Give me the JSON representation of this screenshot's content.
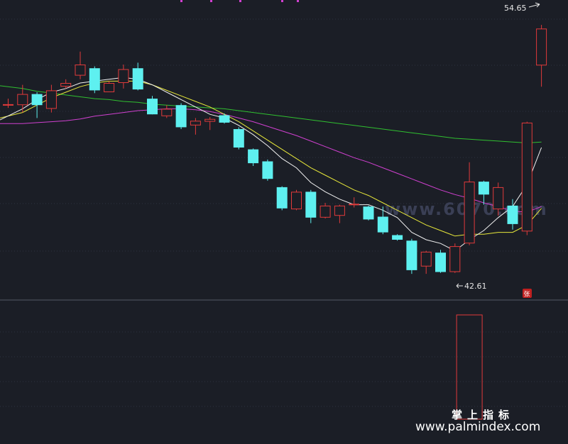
{
  "chart_data": {
    "type": "candlestick",
    "price_range": [
      41.0,
      56.0
    ],
    "high_label": "54.65",
    "low_label": "42.61",
    "limit_up_badge": "张",
    "watermark": "www.6070.com",
    "brand_cn": "掌上指标",
    "brand_url": "www.palmindex.com",
    "colors": {
      "background": "#1b1e26",
      "up": "#e03a3a",
      "down": "#5ef0f0",
      "ma5": "#f2f2f2",
      "ma10": "#e8e83a",
      "ma20": "#d040d0",
      "ma60": "#30c030",
      "grid": "#2e3240",
      "divider": "#555a66"
    },
    "candles": [
      {
        "open": 50.35,
        "close": 50.35,
        "high": 50.65,
        "low": 50.15
      },
      {
        "open": 50.3,
        "close": 50.9,
        "high": 51.4,
        "low": 49.9
      },
      {
        "open": 50.9,
        "close": 50.3,
        "high": 51.0,
        "low": 49.6
      },
      {
        "open": 50.1,
        "close": 51.1,
        "high": 51.4,
        "low": 49.9
      },
      {
        "open": 51.3,
        "close": 51.5,
        "high": 51.7,
        "low": 51.2
      },
      {
        "open": 51.9,
        "close": 52.5,
        "high": 53.2,
        "low": 51.7
      },
      {
        "open": 52.3,
        "close": 51.1,
        "high": 52.4,
        "low": 50.95
      },
      {
        "open": 51.0,
        "close": 51.5,
        "high": 51.6,
        "low": 51.0
      },
      {
        "open": 51.5,
        "close": 52.25,
        "high": 52.5,
        "low": 51.2
      },
      {
        "open": 52.3,
        "close": 51.15,
        "high": 52.6,
        "low": 51.1
      },
      {
        "open": 50.65,
        "close": 49.8,
        "high": 50.8,
        "low": 49.8
      },
      {
        "open": 49.7,
        "close": 50.1,
        "high": 50.3,
        "low": 49.6
      },
      {
        "open": 50.3,
        "close": 49.1,
        "high": 50.4,
        "low": 49.0
      },
      {
        "open": 49.2,
        "close": 49.45,
        "high": 49.6,
        "low": 48.7
      },
      {
        "open": 49.4,
        "close": 49.55,
        "high": 49.65,
        "low": 48.95
      },
      {
        "open": 49.75,
        "close": 49.35,
        "high": 49.85,
        "low": 49.3
      },
      {
        "open": 49.0,
        "close": 48.0,
        "high": 49.1,
        "low": 47.9
      },
      {
        "open": 47.9,
        "close": 47.15,
        "high": 47.95,
        "low": 47.0
      },
      {
        "open": 47.25,
        "close": 46.3,
        "high": 47.35,
        "low": 46.2
      },
      {
        "open": 45.85,
        "close": 44.7,
        "high": 45.9,
        "low": 44.6
      },
      {
        "open": 44.65,
        "close": 45.6,
        "high": 45.7,
        "low": 44.6
      },
      {
        "open": 45.6,
        "close": 44.2,
        "high": 45.7,
        "low": 43.9
      },
      {
        "open": 44.2,
        "close": 44.85,
        "high": 45.0,
        "low": 44.15
      },
      {
        "open": 44.3,
        "close": 44.85,
        "high": 44.9,
        "low": 43.9
      },
      {
        "open": 44.95,
        "close": 44.95,
        "high": 45.3,
        "low": 44.75
      },
      {
        "open": 44.8,
        "close": 44.1,
        "high": 44.85,
        "low": 44.05
      },
      {
        "open": 44.25,
        "close": 43.4,
        "high": 44.8,
        "low": 43.3
      },
      {
        "open": 43.25,
        "close": 43.0,
        "high": 43.3,
        "low": 42.95
      },
      {
        "open": 42.95,
        "close": 41.35,
        "high": 43.05,
        "low": 41.15
      },
      {
        "open": 41.55,
        "close": 42.35,
        "high": 42.4,
        "low": 41.15
      },
      {
        "open": 42.3,
        "close": 41.25,
        "high": 42.45,
        "low": 41.2
      },
      {
        "open": 41.25,
        "close": 42.65,
        "high": 42.8,
        "low": 41.2
      },
      {
        "open": 42.8,
        "close": 46.15,
        "high": 47.2,
        "low": 42.7
      },
      {
        "open": 46.15,
        "close": 45.45,
        "high": 46.2,
        "low": 44.9
      },
      {
        "open": 44.65,
        "close": 45.85,
        "high": 46.1,
        "low": 44.3
      },
      {
        "open": 44.85,
        "close": 43.85,
        "high": 45.2,
        "low": 43.55
      },
      {
        "open": 43.45,
        "close": 49.35,
        "high": 49.4,
        "low": 43.25
      },
      {
        "open": 52.45,
        "close": 54.45,
        "high": 54.65,
        "low": 51.3
      }
    ],
    "ma5": [
      49.5,
      50.1,
      50.6,
      51.0,
      51.2,
      51.5,
      51.6,
      51.7,
      51.8,
      51.7,
      51.4,
      51.0,
      50.6,
      50.2,
      49.8,
      49.6,
      49.2,
      48.7,
      48.1,
      47.4,
      46.9,
      46.1,
      45.6,
      45.2,
      44.9,
      44.9,
      44.6,
      44.2,
      43.4,
      43.0,
      42.8,
      42.4,
      43.0,
      43.5,
      44.2,
      44.8,
      46.0,
      48.0
    ],
    "ma10": [
      49.6,
      49.9,
      50.3,
      50.7,
      51.0,
      51.3,
      51.5,
      51.6,
      51.6,
      51.6,
      51.4,
      51.1,
      50.8,
      50.5,
      50.2,
      49.8,
      49.4,
      48.9,
      48.4,
      47.9,
      47.4,
      46.9,
      46.5,
      46.1,
      45.7,
      45.4,
      45.0,
      44.6,
      44.2,
      43.8,
      43.5,
      43.2,
      43.3,
      43.3,
      43.4,
      43.4,
      43.8,
      44.7
    ],
    "ma20": [
      49.3,
      49.3,
      49.35,
      49.4,
      49.45,
      49.55,
      49.7,
      49.8,
      49.9,
      50.0,
      50.05,
      50.1,
      50.1,
      50.05,
      49.95,
      49.8,
      49.6,
      49.4,
      49.15,
      48.9,
      48.65,
      48.35,
      48.05,
      47.75,
      47.45,
      47.2,
      46.9,
      46.6,
      46.3,
      46.0,
      45.7,
      45.45,
      45.25,
      45.0,
      44.8,
      44.55,
      44.5,
      44.8
    ],
    "ma60": [
      51.35,
      51.2,
      51.05,
      50.95,
      50.85,
      50.75,
      50.65,
      50.6,
      50.5,
      50.45,
      50.35,
      50.3,
      50.25,
      50.2,
      50.15,
      50.1,
      50.0,
      49.9,
      49.8,
      49.7,
      49.6,
      49.5,
      49.4,
      49.3,
      49.2,
      49.1,
      49.0,
      48.9,
      48.8,
      48.7,
      48.6,
      48.5,
      48.45,
      48.4,
      48.35,
      48.3,
      48.25,
      48.3
    ],
    "volume": [
      {
        "index": 32,
        "value": 1.0,
        "direction": "up"
      }
    ]
  }
}
